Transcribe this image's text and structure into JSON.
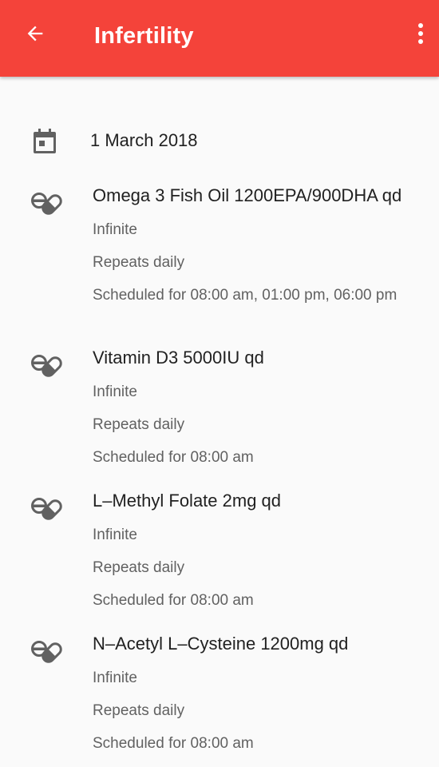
{
  "header": {
    "title": "Infertility",
    "back_icon": "arrow-back-icon",
    "menu_icon": "more-vert-icon",
    "background_color": "#f4433a"
  },
  "date": {
    "icon": "calendar-icon",
    "text": "1 March 2018"
  },
  "medications": [
    {
      "icon": "pills-icon",
      "name": "Omega 3 Fish Oil 1200EPA/900DHA qd",
      "duration": "Infinite",
      "repeat": "Repeats daily",
      "schedule": "Scheduled for 08:00 am, 01:00 pm, 06:00 pm"
    },
    {
      "icon": "pills-icon",
      "name": "Vitamin D3 5000IU qd",
      "duration": "Infinite",
      "repeat": "Repeats daily",
      "schedule": "Scheduled for 08:00 am"
    },
    {
      "icon": "pills-icon",
      "name": "L–Methyl Folate 2mg qd",
      "duration": "Infinite",
      "repeat": "Repeats daily",
      "schedule": "Scheduled for 08:00 am"
    },
    {
      "icon": "pills-icon",
      "name": "N–Acetyl L–Cysteine 1200mg qd",
      "duration": "Infinite",
      "repeat": "Repeats daily",
      "schedule": "Scheduled for 08:00 am"
    }
  ]
}
